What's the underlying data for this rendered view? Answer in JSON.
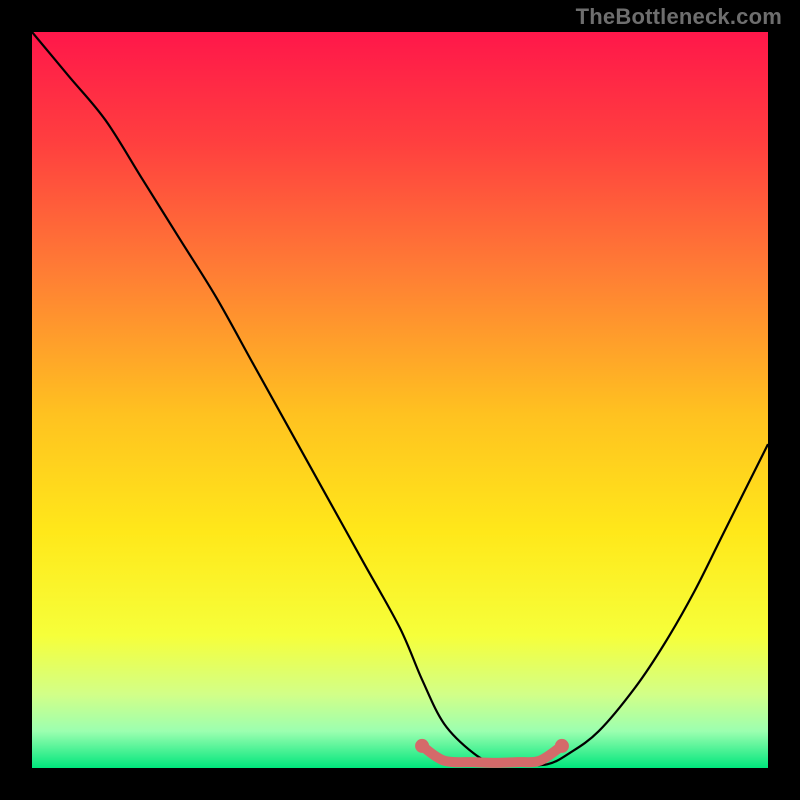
{
  "watermark": "TheBottleneck.com",
  "chart_data": {
    "type": "line",
    "title": "",
    "xlabel": "",
    "ylabel": "",
    "xlim": [
      0,
      100
    ],
    "ylim": [
      0,
      100
    ],
    "series": [
      {
        "name": "curve",
        "x": [
          0,
          5,
          10,
          15,
          20,
          25,
          30,
          35,
          40,
          45,
          50,
          53,
          56,
          60,
          63,
          66,
          70,
          73,
          77,
          82,
          86,
          90,
          94,
          100
        ],
        "values": [
          100,
          94,
          88,
          80,
          72,
          64,
          55,
          46,
          37,
          28,
          19,
          12,
          6,
          2,
          0.5,
          0.4,
          0.5,
          2,
          5,
          11,
          17,
          24,
          32,
          44
        ]
      },
      {
        "name": "marker-band",
        "x": [
          53,
          56,
          60,
          63,
          66,
          69,
          72
        ],
        "values": [
          3,
          1,
          0.8,
          0.7,
          0.8,
          1,
          3
        ]
      }
    ],
    "gradient_stops": [
      {
        "offset": 0.0,
        "color": "#ff174a"
      },
      {
        "offset": 0.15,
        "color": "#ff3f3f"
      },
      {
        "offset": 0.32,
        "color": "#ff7b35"
      },
      {
        "offset": 0.52,
        "color": "#ffc220"
      },
      {
        "offset": 0.68,
        "color": "#ffe81a"
      },
      {
        "offset": 0.82,
        "color": "#f6ff3a"
      },
      {
        "offset": 0.9,
        "color": "#d2ff88"
      },
      {
        "offset": 0.95,
        "color": "#9cffb0"
      },
      {
        "offset": 1.0,
        "color": "#00e67c"
      }
    ],
    "marker_color": "#d46a6a",
    "curve_color": "#000000"
  }
}
